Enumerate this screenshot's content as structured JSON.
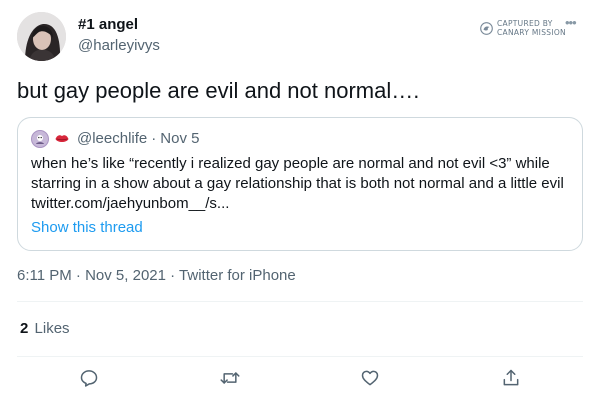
{
  "author": {
    "display_name": "#1 angel",
    "handle": "@harleyivys"
  },
  "watermark": {
    "line1": "CAPTURED BY",
    "line2": "CANARY MISSION"
  },
  "tweet": {
    "text": "but gay people are evil and not normal…."
  },
  "quote": {
    "handle": "@leechlife",
    "separator": "·",
    "date": "Nov 5",
    "lines": [
      "when he’s like “recently i realized gay people are normal and not evil <3” while",
      "starring in a show about a gay relationship that is both not normal and a little evil",
      "twitter.com/jaehyunbom__/s..."
    ],
    "show_thread": "Show this thread"
  },
  "meta": {
    "text": "6:11 PM · Nov 5, 2021 · Twitter for iPhone"
  },
  "stats": {
    "likes_count": "2",
    "likes_label": "Likes"
  },
  "icons": {
    "reply": "reply-icon",
    "retweet": "retweet-icon",
    "like": "like-icon",
    "share": "share-icon"
  },
  "colors": {
    "link": "#1d9bf0",
    "secondary_text": "#536471",
    "primary_text": "#0f1419"
  }
}
